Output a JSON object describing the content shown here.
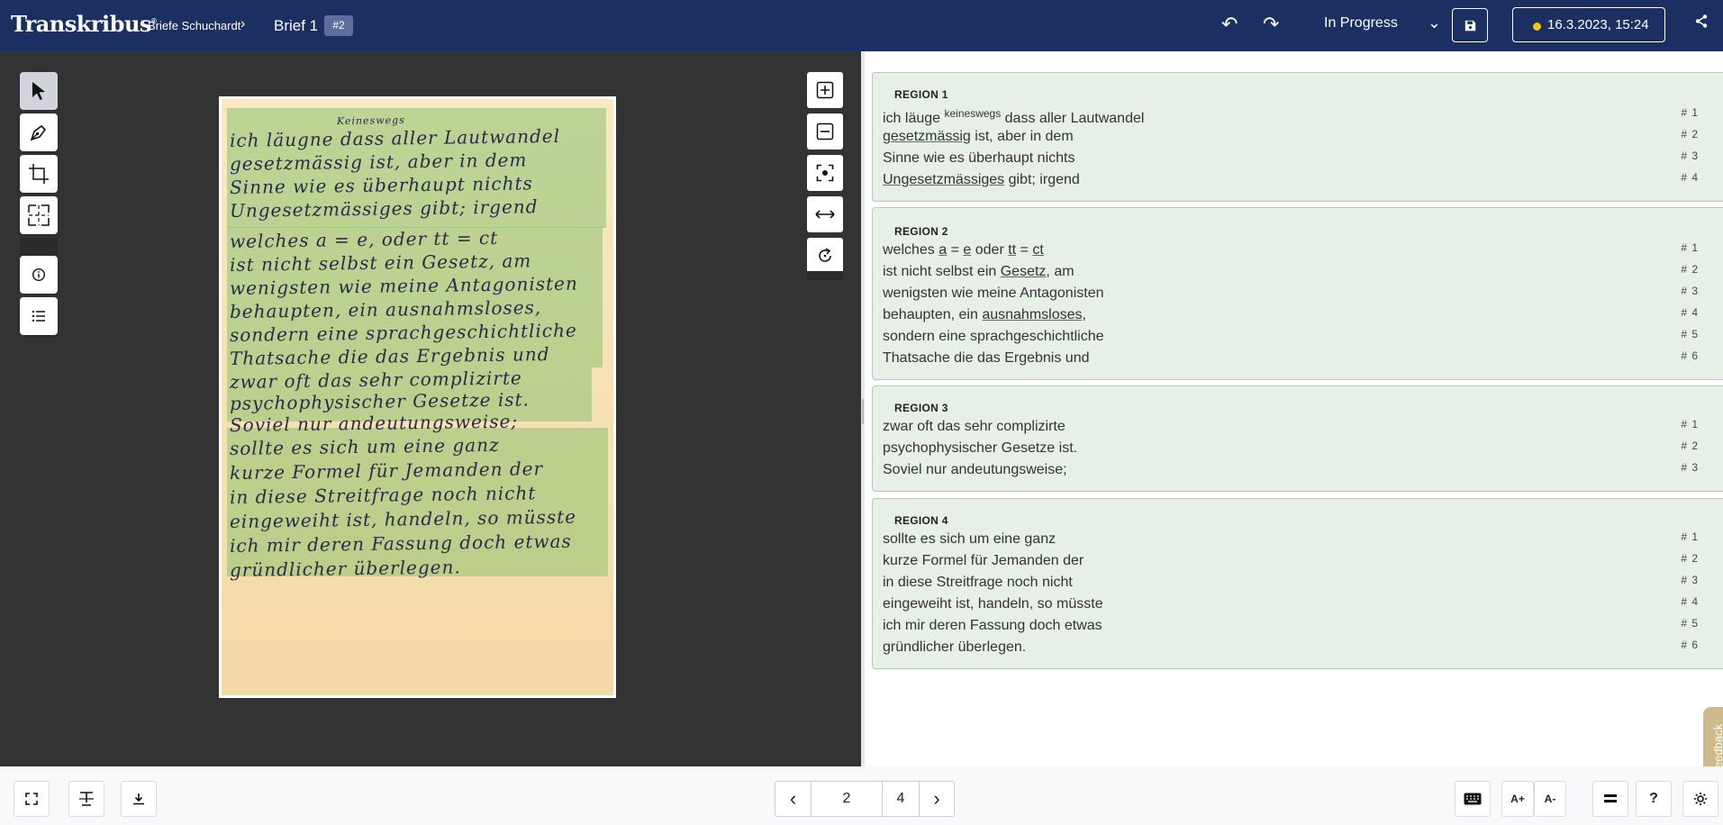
{
  "app": {
    "logo": "Transkribus",
    "logo_mark": "®"
  },
  "header": {
    "breadcrumb_collection": "Briefe Schuchardt",
    "breadcrumb_sep": "›",
    "document_title": "Brief 1",
    "document_badge": "#2",
    "undo_icon": "undo-icon",
    "redo_icon": "redo-icon",
    "status": "In Progress",
    "status_chevron": "⌄",
    "date": "16.3.2023, 15:24",
    "status_dot_color": "#f3c613"
  },
  "viewer": {
    "tools": [
      "select-icon",
      "pen-icon",
      "crop-icon",
      "region-icon",
      "info-icon",
      "list-icon"
    ],
    "zoom_tools": [
      "zoom-in-icon",
      "zoom-out-icon",
      "fit-screen-icon",
      "fit-width-icon",
      "rotate-icon"
    ],
    "annotation": "Keineswegs",
    "handwriting": [
      "ich läugne dass aller Lautwandel",
      "gesetzmässig ist, aber in dem",
      "Sinne wie es überhaupt nichts",
      "Ungesetzmässiges gibt; irgend",
      "welches a = e, oder tt = ct",
      "ist nicht selbst ein Gesetz, am",
      "wenigsten wie meine Antagonisten",
      "behaupten, ein ausnahmsloses,",
      "sondern eine sprachgeschichtliche",
      "Thatsache die das Ergebnis und",
      "zwar oft das sehr complizirte",
      "psychophysischer Gesetze ist.",
      "Soviel nur andeutungsweise;",
      "sollte es sich um eine ganz",
      "kurze Formel für Jemanden der",
      "in diese Streitfrage noch nicht",
      "eingeweiht ist, handeln, so müsste",
      "ich mir deren Fassung doch etwas",
      "gründlicher überlegen."
    ]
  },
  "transcription": {
    "regions": [
      {
        "title": "REGION 1",
        "lines": [
          {
            "num": "# 1",
            "parts": [
              {
                "t": "ich läuge "
              },
              {
                "t": "keineswegs",
                "sup": true
              },
              {
                "t": " dass aller Lautwandel"
              }
            ]
          },
          {
            "num": "# 2",
            "parts": [
              {
                "t": "gesetzmässig",
                "u": true
              },
              {
                "t": " ist, aber in dem"
              }
            ]
          },
          {
            "num": "# 3",
            "parts": [
              {
                "t": "Sinne wie es überhaupt nichts"
              }
            ]
          },
          {
            "num": "# 4",
            "parts": [
              {
                "t": "Ungesetzmässiges",
                "u": true
              },
              {
                "t": " gibt; irgend"
              }
            ]
          }
        ]
      },
      {
        "title": "REGION 2",
        "lines": [
          {
            "num": "# 1",
            "parts": [
              {
                "t": "welches "
              },
              {
                "t": "a",
                "u": true
              },
              {
                "t": " = "
              },
              {
                "t": "e",
                "u": true
              },
              {
                "t": " oder "
              },
              {
                "t": "tt",
                "u": true
              },
              {
                "t": " = "
              },
              {
                "t": "ct",
                "u": true
              }
            ]
          },
          {
            "num": "# 2",
            "parts": [
              {
                "t": "ist nicht selbst ein "
              },
              {
                "t": "Gesetz",
                "u": true
              },
              {
                "t": ", am"
              }
            ]
          },
          {
            "num": "# 3",
            "parts": [
              {
                "t": "wenigsten wie meine Antagonisten"
              }
            ]
          },
          {
            "num": "# 4",
            "parts": [
              {
                "t": "behaupten, ein "
              },
              {
                "t": "ausnahmsloses",
                "u": true
              },
              {
                "t": ","
              }
            ]
          },
          {
            "num": "# 5",
            "parts": [
              {
                "t": "sondern eine sprachgeschichtliche"
              }
            ]
          },
          {
            "num": "# 6",
            "parts": [
              {
                "t": "Thatsache die das Ergebnis und"
              }
            ]
          }
        ]
      },
      {
        "title": "REGION 3",
        "lines": [
          {
            "num": "# 1",
            "parts": [
              {
                "t": "zwar oft das sehr complizirte"
              }
            ]
          },
          {
            "num": "# 2",
            "parts": [
              {
                "t": "psychophysischer Gesetze ist."
              }
            ]
          },
          {
            "num": "# 3",
            "parts": [
              {
                "t": "Soviel nur andeutungsweise;"
              }
            ]
          }
        ]
      },
      {
        "title": "REGION 4",
        "lines": [
          {
            "num": "# 1",
            "parts": [
              {
                "t": "sollte es sich um eine ganz"
              }
            ]
          },
          {
            "num": "# 2",
            "parts": [
              {
                "t": "kurze Formel für Jemanden der"
              }
            ]
          },
          {
            "num": "# 3",
            "parts": [
              {
                "t": "in diese Streitfrage noch nicht"
              }
            ]
          },
          {
            "num": "# 4",
            "parts": [
              {
                "t": "eingeweiht ist, handeln, so müsste"
              }
            ]
          },
          {
            "num": "# 5",
            "parts": [
              {
                "t": "ich mir deren Fassung doch etwas"
              }
            ]
          },
          {
            "num": "# 6",
            "parts": [
              {
                "t": "gründlicher überlegen."
              }
            ]
          }
        ]
      }
    ]
  },
  "feedback": {
    "label": "Feedback"
  },
  "footer": {
    "current_page": "2",
    "total_pages": "4",
    "prev_icon": "‹",
    "next_icon": "›",
    "font_increase": "A+",
    "font_decrease": "A-",
    "help": "?"
  }
}
